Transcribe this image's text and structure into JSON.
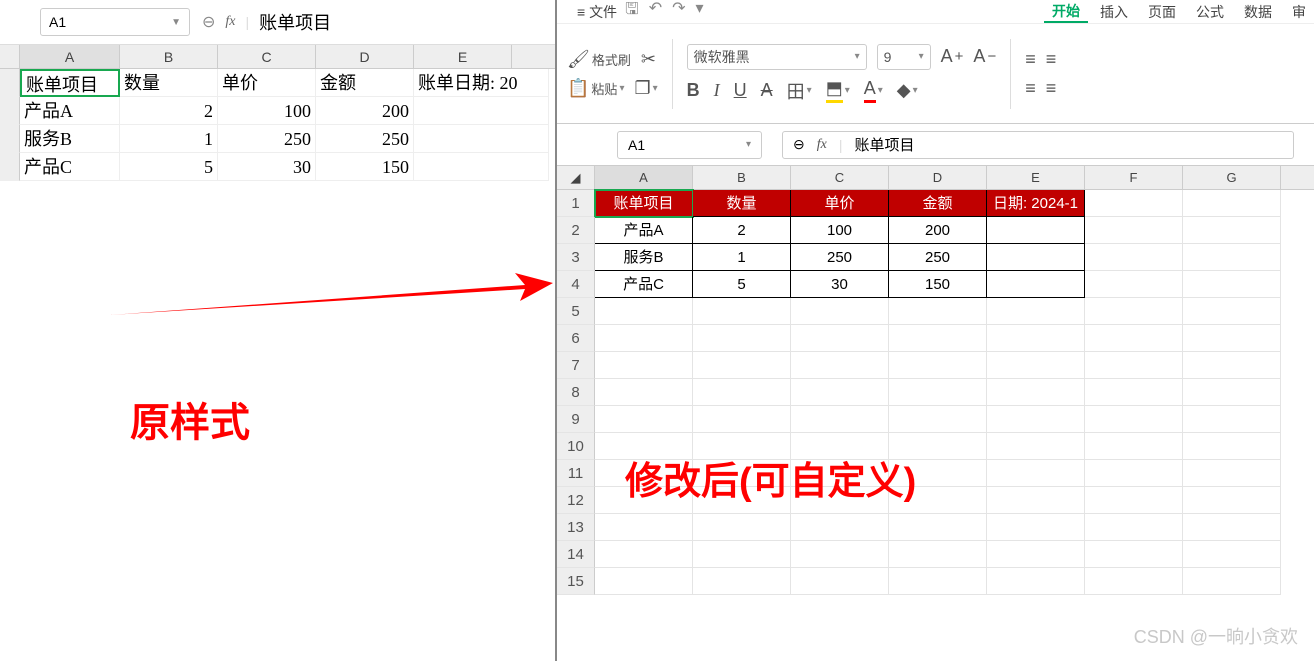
{
  "left": {
    "namebox": "A1",
    "formula": "账单项目",
    "columns": [
      "A",
      "B",
      "C",
      "D",
      "E"
    ],
    "headers": [
      "账单项目",
      "数量",
      "单价",
      "金额",
      "账单日期: 20"
    ],
    "rows": [
      {
        "a": "产品A",
        "b": "2",
        "c": "100",
        "d": "200",
        "e": ""
      },
      {
        "a": "服务B",
        "b": "1",
        "c": "250",
        "d": "250",
        "e": ""
      },
      {
        "a": "产品C",
        "b": "5",
        "c": "30",
        "d": "150",
        "e": ""
      }
    ],
    "caption": "原样式"
  },
  "right": {
    "menu": {
      "file": "文件",
      "items": [
        "开始",
        "插入",
        "页面",
        "公式",
        "数据",
        "审"
      ]
    },
    "ribbon": {
      "format_painter": "格式刷",
      "paste": "粘贴",
      "font": "微软雅黑",
      "size": "9",
      "icons": {
        "cut": "✂",
        "bold": "B",
        "italic": "I",
        "underline": "U",
        "strike": "A",
        "border": "田",
        "fill": "⬒",
        "color": "A",
        "highlight": "◆",
        "asup": "A",
        "asub": "A"
      }
    },
    "namebox": "A1",
    "formula": "账单项目",
    "columns": [
      "A",
      "B",
      "C",
      "D",
      "E",
      "F",
      "G"
    ],
    "headers": [
      "账单项目",
      "数量",
      "单价",
      "金额",
      "日期: 2024-1"
    ],
    "rows": [
      {
        "n": "2",
        "a": "产品A",
        "b": "2",
        "c": "100",
        "d": "200"
      },
      {
        "n": "3",
        "a": "服务B",
        "b": "1",
        "c": "250",
        "d": "250"
      },
      {
        "n": "4",
        "a": "产品C",
        "b": "5",
        "c": "30",
        "d": "150"
      }
    ],
    "emptyrows": [
      "5",
      "6",
      "7",
      "8",
      "9",
      "10",
      "11",
      "12",
      "13",
      "14",
      "15"
    ],
    "caption": "修改后(可自定义)"
  },
  "watermark": "CSDN @一晌小贪欢"
}
